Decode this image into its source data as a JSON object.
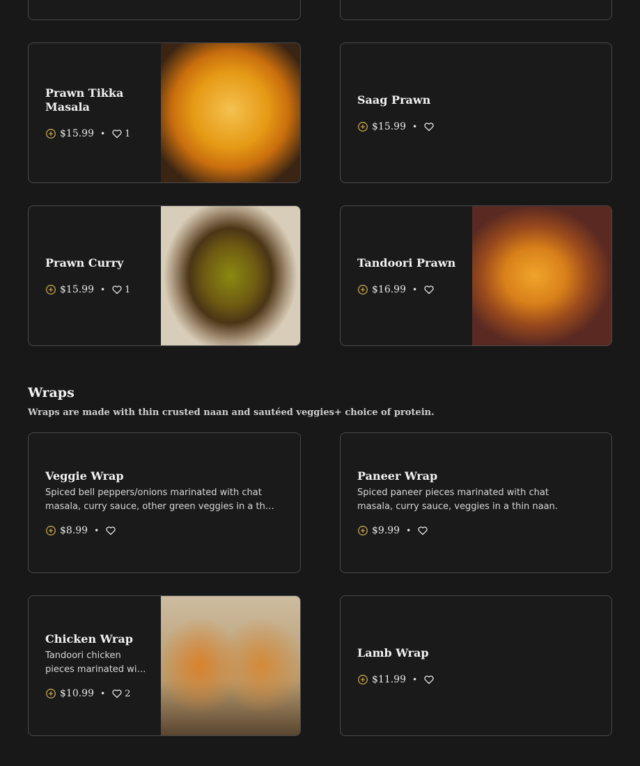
{
  "colors": {
    "background": "#181818",
    "card_border": "#4a4a4a",
    "accent_icon": "#c9a44c",
    "text": "#f2f2f2"
  },
  "icons": {
    "add": "plus-circle-icon",
    "favorite": "heart-icon"
  },
  "prawn_items": [
    {
      "name": "Prawn Tikka Masala",
      "price": "$15.99",
      "likes": "1"
    },
    {
      "name": "Saag Prawn",
      "price": "$15.99",
      "likes": ""
    },
    {
      "name": "Prawn Curry",
      "price": "$15.99",
      "likes": "1"
    },
    {
      "name": "Tandoori Prawn",
      "price": "$16.99",
      "likes": ""
    }
  ],
  "wraps": {
    "title": "Wraps",
    "description": "Wraps are made with thin crusted naan and sautéed veggies+ choice of protein.",
    "items": [
      {
        "name": "Veggie Wrap",
        "description": "Spiced bell peppers/onions marinated with chat masala, curry sauce, other green veggies in a thin naan.",
        "price": "$8.99",
        "likes": ""
      },
      {
        "name": "Paneer Wrap",
        "description": "Spiced paneer pieces marinated with chat masala, curry sauce, veggies in a thin naan.",
        "price": "$9.99",
        "likes": ""
      },
      {
        "name": "Chicken Wrap",
        "description": "Tandoori chicken pieces marinated with chat masala, curry sauce, veggies in a thin naan.",
        "price": "$10.99",
        "likes": "2"
      },
      {
        "name": "Lamb Wrap",
        "price": "$11.99",
        "likes": ""
      }
    ]
  }
}
